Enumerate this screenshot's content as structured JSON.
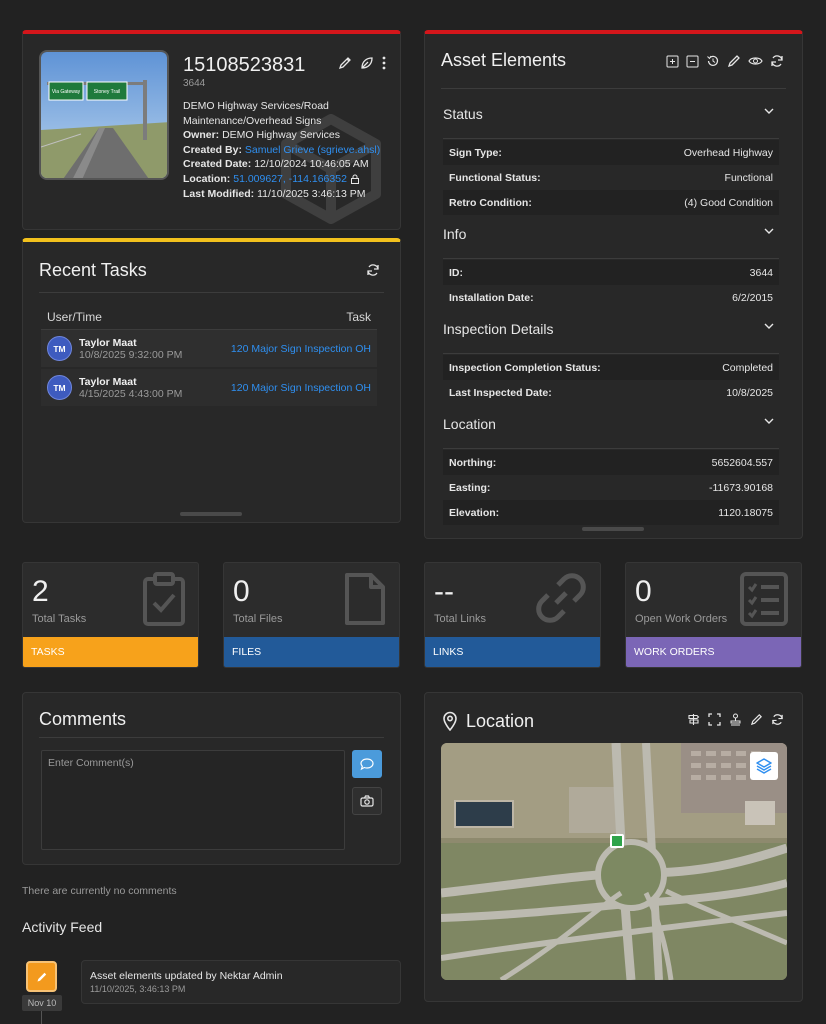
{
  "asset": {
    "id": "15108523831",
    "sub_id": "3644",
    "type_line": "DEMO  Highway Services/Road Maintenance/Overhead Signs",
    "owner_label": "Owner:",
    "owner_value": "DEMO Highway Services",
    "created_by_label": "Created By:",
    "created_by_value": "Samuel Grieve (sgrieve.ahsl)",
    "created_date_label": "Created Date:",
    "created_date_value": "12/10/2024 10:46:05 AM",
    "location_label": "Location:",
    "location_value": "51.009627, -114.166352",
    "last_modified_label": "Last Modified:",
    "last_modified_value": "11/10/2025 3:46:13 PM",
    "thumb_sign_text_left": "Via Gateway",
    "thumb_sign_text_right": "Stoney Trail"
  },
  "recent_tasks": {
    "title": "Recent Tasks",
    "col_user": "User/Time",
    "col_task": "Task",
    "rows": [
      {
        "initials": "TM",
        "user": "Taylor Maat",
        "time": "10/8/2025 9:32:00 PM",
        "task": "120 Major Sign Inspection OH"
      },
      {
        "initials": "TM",
        "user": "Taylor Maat",
        "time": "4/15/2025 4:43:00 PM",
        "task": "120 Major Sign Inspection OH"
      }
    ]
  },
  "asset_elements": {
    "title": "Asset Elements",
    "sections": [
      {
        "title": "Status",
        "rows": [
          {
            "key": "Sign Type:",
            "value": "Overhead Highway"
          },
          {
            "key": "Functional Status:",
            "value": "Functional"
          },
          {
            "key": "Retro Condition:",
            "value": "(4) Good Condition"
          }
        ]
      },
      {
        "title": "Info",
        "rows": [
          {
            "key": "ID:",
            "value": "3644"
          },
          {
            "key": "Installation Date:",
            "value": "6/2/2015"
          }
        ]
      },
      {
        "title": "Inspection Details",
        "rows": [
          {
            "key": "Inspection Completion Status:",
            "value": "Completed"
          },
          {
            "key": "Last Inspected Date:",
            "value": "10/8/2025"
          }
        ]
      },
      {
        "title": "Location",
        "rows": [
          {
            "key": "Northing:",
            "value": "5652604.557"
          },
          {
            "key": "Easting:",
            "value": "-11673.90168"
          },
          {
            "key": "Elevation:",
            "value": "1120.18075"
          }
        ]
      }
    ]
  },
  "tiles": [
    {
      "number": "2",
      "label": "Total Tasks",
      "bar": "TASKS",
      "color": "#f7a21b",
      "icon": "clipboard-check-icon"
    },
    {
      "number": "0",
      "label": "Total Files",
      "bar": "FILES",
      "color": "#225a99",
      "icon": "file-icon"
    },
    {
      "number": "--",
      "label": "Total Links",
      "bar": "LINKS",
      "color": "#225a99",
      "icon": "link-icon"
    },
    {
      "number": "0",
      "label": "Open Work Orders",
      "bar": "WORK ORDERS",
      "color": "#7b66b6",
      "icon": "checklist-icon"
    }
  ],
  "comments": {
    "title": "Comments",
    "placeholder": "Enter Comment(s)",
    "empty_text": "There are currently no comments"
  },
  "activity": {
    "title": "Activity Feed",
    "items": [
      {
        "date": "Nov 10",
        "text": "Asset elements updated by Nektar Admin",
        "time": "11/10/2025, 3:46:13 PM"
      }
    ]
  },
  "location_card": {
    "title": "Location"
  },
  "colors": {
    "accent_red": "#d4161b",
    "accent_yellow": "#f2c11d",
    "link_blue": "#2f8ff0",
    "tasks_orange": "#f7a21b",
    "files_blue": "#225a99",
    "work_orders_purple": "#7b66b6"
  }
}
